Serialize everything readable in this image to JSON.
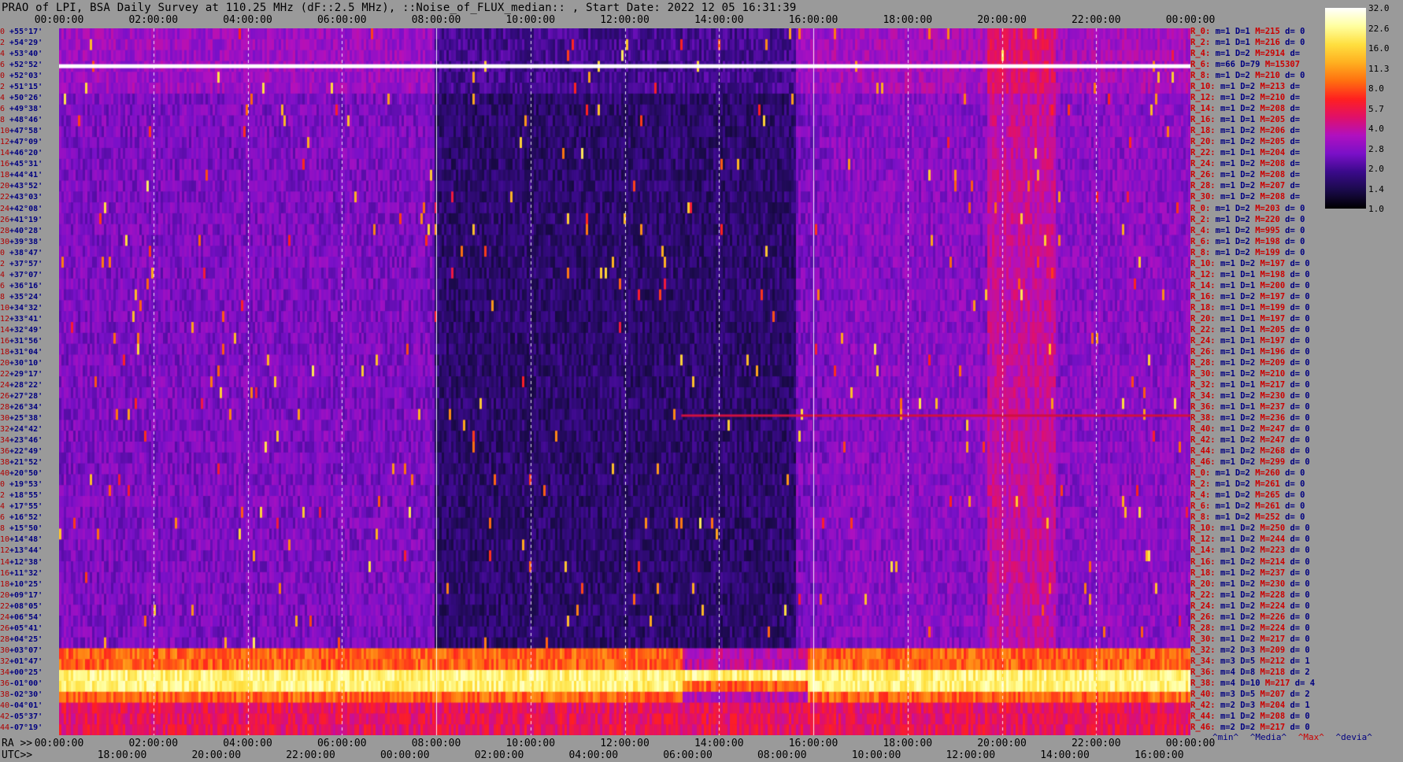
{
  "title": "PRAO of LPI, BSA Daily Survey at 110.25 MHz (dF::2.5 MHz), ::Noise_of_FLUX_median:: , Start Date: 2022 12 05 16:31:39",
  "chart_data": {
    "type": "heatmap",
    "title": "PRAO of LPI, BSA Daily Survey at 110.25 MHz (dF::2.5 MHz), ::Noise_of_FLUX_median:: , Start Date: 2022 12 05 16:31:39",
    "x_top_ticks": [
      "00:00:00",
      "02:00:00",
      "04:00:00",
      "06:00:00",
      "08:00:00",
      "10:00:00",
      "12:00:00",
      "14:00:00",
      "16:00:00",
      "18:00:00",
      "20:00:00",
      "22:00:00",
      "00:00:00"
    ],
    "x_bottom_ra_label": "RA >>",
    "x_bottom_ra_ticks": [
      "00:00:00",
      "02:00:00",
      "04:00:00",
      "06:00:00",
      "08:00:00",
      "10:00:00",
      "12:00:00",
      "14:00:00",
      "16:00:00",
      "18:00:00",
      "20:00:00",
      "22:00:00",
      "00:00:00"
    ],
    "x_bottom_utc_label": "UTC>>",
    "x_bottom_utc_ticks": [
      "18:00:00",
      "20:00:00",
      "22:00:00",
      "00:00:00",
      "02:00:00",
      "04:00:00",
      "06:00:00",
      "08:00:00",
      "10:00:00",
      "12:00:00",
      "14:00:00",
      "16:00:00"
    ],
    "y_labels": [
      {
        "i": "0",
        "d": "+55°17'"
      },
      {
        "i": "2",
        "d": "+54°29'"
      },
      {
        "i": "4",
        "d": "+53°40'"
      },
      {
        "i": "6",
        "d": "+52°52'"
      },
      {
        "i": "0",
        "d": "+52°03'"
      },
      {
        "i": "2",
        "d": "+51°15'"
      },
      {
        "i": "4",
        "d": "+50°26'"
      },
      {
        "i": "6",
        "d": "+49°38'"
      },
      {
        "i": "8",
        "d": "+48°46'"
      },
      {
        "i": "10",
        "d": "+47°58'"
      },
      {
        "i": "12",
        "d": "+47°09'"
      },
      {
        "i": "14",
        "d": "+46°20'"
      },
      {
        "i": "16",
        "d": "+45°31'"
      },
      {
        "i": "18",
        "d": "+44°41'"
      },
      {
        "i": "20",
        "d": "+43°52'"
      },
      {
        "i": "22",
        "d": "+43°03'"
      },
      {
        "i": "24",
        "d": "+42°08'"
      },
      {
        "i": "26",
        "d": "+41°19'"
      },
      {
        "i": "28",
        "d": "+40°28'"
      },
      {
        "i": "30",
        "d": "+39°38'"
      },
      {
        "i": "0",
        "d": "+38°47'"
      },
      {
        "i": "2",
        "d": "+37°57'"
      },
      {
        "i": "4",
        "d": "+37°07'"
      },
      {
        "i": "6",
        "d": "+36°16'"
      },
      {
        "i": "8",
        "d": "+35°24'"
      },
      {
        "i": "10",
        "d": "+34°32'"
      },
      {
        "i": "12",
        "d": "+33°41'"
      },
      {
        "i": "14",
        "d": "+32°49'"
      },
      {
        "i": "16",
        "d": "+31°56'"
      },
      {
        "i": "18",
        "d": "+31°04'"
      },
      {
        "i": "20",
        "d": "+30°10'"
      },
      {
        "i": "22",
        "d": "+29°17'"
      },
      {
        "i": "24",
        "d": "+28°22'"
      },
      {
        "i": "26",
        "d": "+27°28'"
      },
      {
        "i": "28",
        "d": "+26°34'"
      },
      {
        "i": "30",
        "d": "+25°38'"
      },
      {
        "i": "32",
        "d": "+24°42'"
      },
      {
        "i": "34",
        "d": "+23°46'"
      },
      {
        "i": "36",
        "d": "+22°49'"
      },
      {
        "i": "38",
        "d": "+21°52'"
      },
      {
        "i": "40",
        "d": "+20°50'"
      },
      {
        "i": "0",
        "d": "+19°53'"
      },
      {
        "i": "2",
        "d": "+18°55'"
      },
      {
        "i": "4",
        "d": "+17°55'"
      },
      {
        "i": "6",
        "d": "+16°52'"
      },
      {
        "i": "8",
        "d": "+15°50'"
      },
      {
        "i": "10",
        "d": "+14°48'"
      },
      {
        "i": "12",
        "d": "+13°44'"
      },
      {
        "i": "14",
        "d": "+12°38'"
      },
      {
        "i": "16",
        "d": "+11°32'"
      },
      {
        "i": "18",
        "d": "+10°25'"
      },
      {
        "i": "20",
        "d": "+09°17'"
      },
      {
        "i": "22",
        "d": "+08°05'"
      },
      {
        "i": "24",
        "d": "+06°54'"
      },
      {
        "i": "26",
        "d": "+05°41'"
      },
      {
        "i": "28",
        "d": "+04°25'"
      },
      {
        "i": "30",
        "d": "+03°07'"
      },
      {
        "i": "32",
        "d": "+01°47'"
      },
      {
        "i": "34",
        "d": "+00°25'"
      },
      {
        "i": "36",
        "d": "-01°00'"
      },
      {
        "i": "38",
        "d": "-02°30'"
      },
      {
        "i": "40",
        "d": "-04°01'"
      },
      {
        "i": "42",
        "d": "-05°37'"
      },
      {
        "i": "44",
        "d": "-07°19'"
      }
    ],
    "row_stats": [
      {
        "r": "R_0:",
        "m": "m=1",
        "D": "D=1",
        "M": "M=215",
        "d": "d= 0"
      },
      {
        "r": "R_2:",
        "m": "m=1",
        "D": "D=1",
        "M": "M=216",
        "d": "d= 0"
      },
      {
        "r": "R_4:",
        "m": "m=1",
        "D": "D=2",
        "M": "M=2914",
        "d": "d="
      },
      {
        "r": "R_6:",
        "m": "m=66",
        "D": "D=79",
        "M": "M=15307",
        "d": ""
      },
      {
        "r": "R_8:",
        "m": "m=1",
        "D": "D=2",
        "M": "M=210",
        "d": "d= 0"
      },
      {
        "r": "R_10:",
        "m": "m=1",
        "D": "D=2",
        "M": "M=213",
        "d": "d="
      },
      {
        "r": "R_12:",
        "m": "m=1",
        "D": "D=2",
        "M": "M=210",
        "d": "d="
      },
      {
        "r": "R_14:",
        "m": "m=1",
        "D": "D=2",
        "M": "M=208",
        "d": "d="
      },
      {
        "r": "R_16:",
        "m": "m=1",
        "D": "D=1",
        "M": "M=205",
        "d": "d="
      },
      {
        "r": "R_18:",
        "m": "m=1",
        "D": "D=2",
        "M": "M=206",
        "d": "d="
      },
      {
        "r": "R_20:",
        "m": "m=1",
        "D": "D=2",
        "M": "M=205",
        "d": "d="
      },
      {
        "r": "R_22:",
        "m": "m=1",
        "D": "D=1",
        "M": "M=204",
        "d": "d="
      },
      {
        "r": "R_24:",
        "m": "m=1",
        "D": "D=2",
        "M": "M=208",
        "d": "d="
      },
      {
        "r": "R_26:",
        "m": "m=1",
        "D": "D=2",
        "M": "M=208",
        "d": "d="
      },
      {
        "r": "R_28:",
        "m": "m=1",
        "D": "D=2",
        "M": "M=207",
        "d": "d="
      },
      {
        "r": "R_30:",
        "m": "m=1",
        "D": "D=2",
        "M": "M=208",
        "d": "d="
      },
      {
        "r": "R_0:",
        "m": "m=1",
        "D": "D=2",
        "M": "M=203",
        "d": "d= 0"
      },
      {
        "r": "R_2:",
        "m": "m=1",
        "D": "D=2",
        "M": "M=220",
        "d": "d= 0"
      },
      {
        "r": "R_4:",
        "m": "m=1",
        "D": "D=2",
        "M": "M=995",
        "d": "d= 0"
      },
      {
        "r": "R_6:",
        "m": "m=1",
        "D": "D=2",
        "M": "M=198",
        "d": "d= 0"
      },
      {
        "r": "R_8:",
        "m": "m=1",
        "D": "D=2",
        "M": "M=199",
        "d": "d= 0"
      },
      {
        "r": "R_10:",
        "m": "m=1",
        "D": "D=2",
        "M": "M=197",
        "d": "d= 0"
      },
      {
        "r": "R_12:",
        "m": "m=1",
        "D": "D=1",
        "M": "M=198",
        "d": "d= 0"
      },
      {
        "r": "R_14:",
        "m": "m=1",
        "D": "D=1",
        "M": "M=200",
        "d": "d= 0"
      },
      {
        "r": "R_16:",
        "m": "m=1",
        "D": "D=2",
        "M": "M=197",
        "d": "d= 0"
      },
      {
        "r": "R_18:",
        "m": "m=1",
        "D": "D=1",
        "M": "M=199",
        "d": "d= 0"
      },
      {
        "r": "R_20:",
        "m": "m=1",
        "D": "D=1",
        "M": "M=197",
        "d": "d= 0"
      },
      {
        "r": "R_22:",
        "m": "m=1",
        "D": "D=1",
        "M": "M=205",
        "d": "d= 0"
      },
      {
        "r": "R_24:",
        "m": "m=1",
        "D": "D=1",
        "M": "M=197",
        "d": "d= 0"
      },
      {
        "r": "R_26:",
        "m": "m=1",
        "D": "D=1",
        "M": "M=196",
        "d": "d= 0"
      },
      {
        "r": "R_28:",
        "m": "m=1",
        "D": "D=2",
        "M": "M=209",
        "d": "d= 0"
      },
      {
        "r": "R_30:",
        "m": "m=1",
        "D": "D=2",
        "M": "M=210",
        "d": "d= 0"
      },
      {
        "r": "R_32:",
        "m": "m=1",
        "D": "D=1",
        "M": "M=217",
        "d": "d= 0"
      },
      {
        "r": "R_34:",
        "m": "m=1",
        "D": "D=2",
        "M": "M=230",
        "d": "d= 0"
      },
      {
        "r": "R_36:",
        "m": "m=1",
        "D": "D=1",
        "M": "M=237",
        "d": "d= 0"
      },
      {
        "r": "R_38:",
        "m": "m=1",
        "D": "D=2",
        "M": "M=236",
        "d": "d= 0"
      },
      {
        "r": "R_40:",
        "m": "m=1",
        "D": "D=2",
        "M": "M=247",
        "d": "d= 0"
      },
      {
        "r": "R_42:",
        "m": "m=1",
        "D": "D=2",
        "M": "M=247",
        "d": "d= 0"
      },
      {
        "r": "R_44:",
        "m": "m=1",
        "D": "D=2",
        "M": "M=268",
        "d": "d= 0"
      },
      {
        "r": "R_46:",
        "m": "m=1",
        "D": "D=2",
        "M": "M=299",
        "d": "d= 0"
      },
      {
        "r": "R_0:",
        "m": "m=1",
        "D": "D=2",
        "M": "M=260",
        "d": "d= 0"
      },
      {
        "r": "R_2:",
        "m": "m=1",
        "D": "D=2",
        "M": "M=261",
        "d": "d= 0"
      },
      {
        "r": "R_4:",
        "m": "m=1",
        "D": "D=2",
        "M": "M=265",
        "d": "d= 0"
      },
      {
        "r": "R_6:",
        "m": "m=1",
        "D": "D=2",
        "M": "M=261",
        "d": "d= 0"
      },
      {
        "r": "R_8:",
        "m": "m=1",
        "D": "D=2",
        "M": "M=252",
        "d": "d= 0"
      },
      {
        "r": "R_10:",
        "m": "m=1",
        "D": "D=2",
        "M": "M=250",
        "d": "d= 0"
      },
      {
        "r": "R_12:",
        "m": "m=1",
        "D": "D=2",
        "M": "M=244",
        "d": "d= 0"
      },
      {
        "r": "R_14:",
        "m": "m=1",
        "D": "D=2",
        "M": "M=223",
        "d": "d= 0"
      },
      {
        "r": "R_16:",
        "m": "m=1",
        "D": "D=2",
        "M": "M=214",
        "d": "d= 0"
      },
      {
        "r": "R_18:",
        "m": "m=1",
        "D": "D=2",
        "M": "M=237",
        "d": "d= 0"
      },
      {
        "r": "R_20:",
        "m": "m=1",
        "D": "D=2",
        "M": "M=230",
        "d": "d= 0"
      },
      {
        "r": "R_22:",
        "m": "m=1",
        "D": "D=2",
        "M": "M=228",
        "d": "d= 0"
      },
      {
        "r": "R_24:",
        "m": "m=1",
        "D": "D=2",
        "M": "M=224",
        "d": "d= 0"
      },
      {
        "r": "R_26:",
        "m": "m=1",
        "D": "D=2",
        "M": "M=226",
        "d": "d= 0"
      },
      {
        "r": "R_28:",
        "m": "m=1",
        "D": "D=2",
        "M": "M=224",
        "d": "d= 0"
      },
      {
        "r": "R_30:",
        "m": "m=1",
        "D": "D=2",
        "M": "M=217",
        "d": "d= 0"
      },
      {
        "r": "R_32:",
        "m": "m=2",
        "D": "D=3",
        "M": "M=209",
        "d": "d= 0"
      },
      {
        "r": "R_34:",
        "m": "m=3",
        "D": "D=5",
        "M": "M=212",
        "d": "d= 1"
      },
      {
        "r": "R_36:",
        "m": "m=4",
        "D": "D=8",
        "M": "M=218",
        "d": "d= 2"
      },
      {
        "r": "R_38:",
        "m": "m=4",
        "D": "D=10",
        "M": "M=217",
        "d": "d= 4"
      },
      {
        "r": "R_40:",
        "m": "m=3",
        "D": "D=5",
        "M": "M=207",
        "d": "d= 2"
      },
      {
        "r": "R_42:",
        "m": "m=2",
        "D": "D=3",
        "M": "M=204",
        "d": "d= 1"
      },
      {
        "r": "R_44:",
        "m": "m=1",
        "D": "D=2",
        "M": "M=208",
        "d": "d= 0"
      },
      {
        "r": "R_46:",
        "m": "m=2",
        "D": "D=2",
        "M": "M=217",
        "d": "d= 0"
      }
    ],
    "colorbar": {
      "labels": [
        "32.0",
        "22.6",
        "16.0",
        "11.3",
        "8.0",
        "5.7",
        "4.0",
        "2.8",
        "2.0",
        "1.4",
        "1.0"
      ],
      "colors": [
        "#000000",
        "#1a0a4a",
        "#3a0a8a",
        "#7a10c8",
        "#b010c0",
        "#e0106a",
        "#ff2020",
        "#ff7010",
        "#ffb020",
        "#ffe040",
        "#ffffa0",
        "#ffffff"
      ]
    },
    "grid": true
  },
  "legend": {
    "min": "^min^",
    "median": "^Media^",
    "max": "^Max^",
    "dev": "^devia^"
  }
}
